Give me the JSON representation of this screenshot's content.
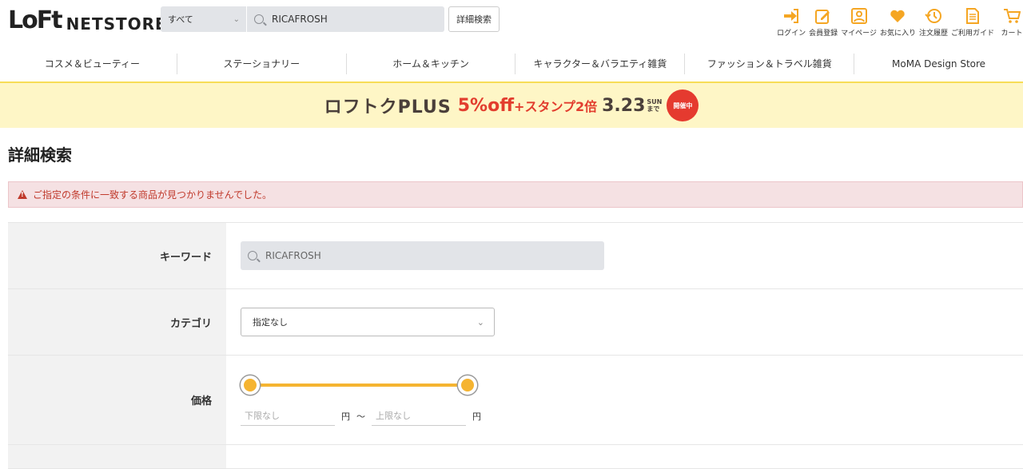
{
  "header": {
    "logo_loft": "LoFt",
    "logo_netstore": "NETSTORE",
    "search_scope": "すべて",
    "search_value": "RICAFROSH",
    "advanced_search_label": "詳細検索",
    "util": [
      {
        "label": "ログイン",
        "icon": "login-icon"
      },
      {
        "label": "会員登録",
        "icon": "register-icon"
      },
      {
        "label": "マイページ",
        "icon": "user-icon"
      },
      {
        "label": "お気に入り",
        "icon": "heart-icon"
      },
      {
        "label": "注文履歴",
        "icon": "history-icon"
      },
      {
        "label": "ご利用ガイド",
        "icon": "guide-icon"
      },
      {
        "label": "カート",
        "icon": "cart-icon"
      }
    ],
    "accent_color": "#f5a623"
  },
  "nav": {
    "items": [
      "コスメ＆ビューティー",
      "ステーショナリー",
      "ホーム＆キッチン",
      "キャラクター＆バラエティ雑貨",
      "ファッション＆トラベル雑貨",
      "MoMA Design Store"
    ]
  },
  "banner": {
    "brand": "ロフトクPLUS",
    "offer_main": "5%off",
    "offer_plus": "+スタンプ2倍",
    "date": "3.23",
    "day": "SUN",
    "until": "まで",
    "badge": "開催中"
  },
  "page": {
    "title": "詳細検索",
    "alert": "ご指定の条件に一致する商品が見つかりませんでした。"
  },
  "form": {
    "keyword_label": "キーワード",
    "keyword_value": "RICAFROSH",
    "category_label": "カテゴリ",
    "category_value": "指定なし",
    "price_label": "価格",
    "price_min_placeholder": "下限なし",
    "price_max_placeholder": "上限なし",
    "yen": "円",
    "tilde": "〜",
    "slider_min": 0,
    "slider_max": 1
  }
}
